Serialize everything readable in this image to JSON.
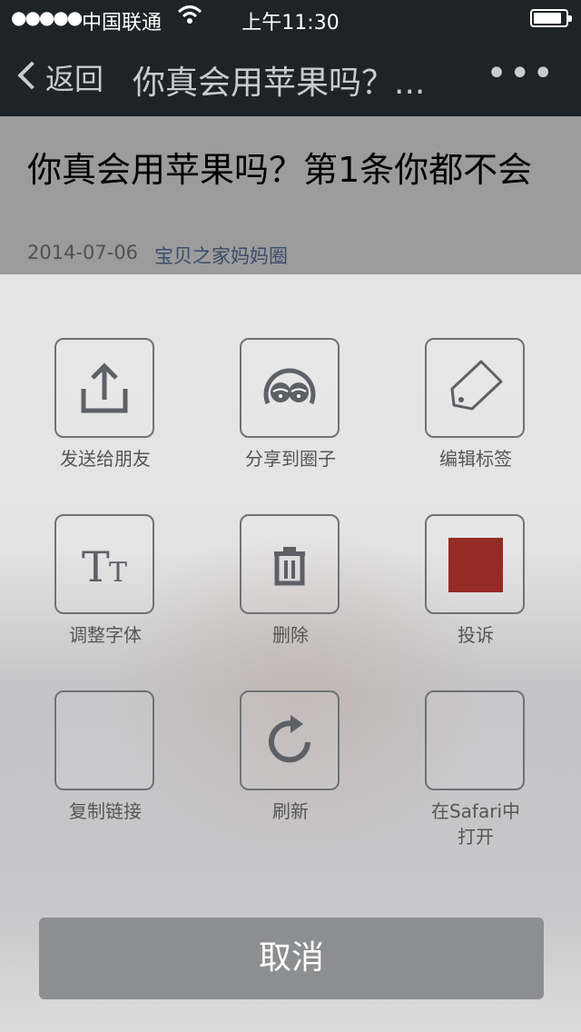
{
  "status_bar": {
    "signal": "●●●●●",
    "carrier": "中国联通",
    "time": "上午11:30"
  },
  "nav": {
    "back_label": "返回",
    "title": "你真会用苹果吗？...",
    "more": "•••"
  },
  "article": {
    "title": "你真会用苹果吗？第1条你都不会",
    "date": "2014-07-06",
    "source": "宝贝之家妈妈圈"
  },
  "actions": [
    {
      "label": "发送给朋友",
      "icon": "share-upload-icon"
    },
    {
      "label": "分享到圈子",
      "icon": "circle-friends-icon"
    },
    {
      "label": "编辑标签",
      "icon": "tag-icon"
    },
    {
      "label": "调整字体",
      "icon": "font-size-icon"
    },
    {
      "label": "删除",
      "icon": "trash-icon"
    },
    {
      "label": "投诉",
      "icon": "report-icon",
      "color": "#952b25"
    },
    {
      "label": "复制链接",
      "icon": "copy-link-icon"
    },
    {
      "label": "刷新",
      "icon": "refresh-icon"
    },
    {
      "label": "在Safari中打开",
      "icon": "safari-icon"
    }
  ],
  "cancel_label": "取消",
  "colors": {
    "nav_bg": "#1e2325",
    "accent_report": "#952b25",
    "cancel_bg": "#8d8e90"
  }
}
